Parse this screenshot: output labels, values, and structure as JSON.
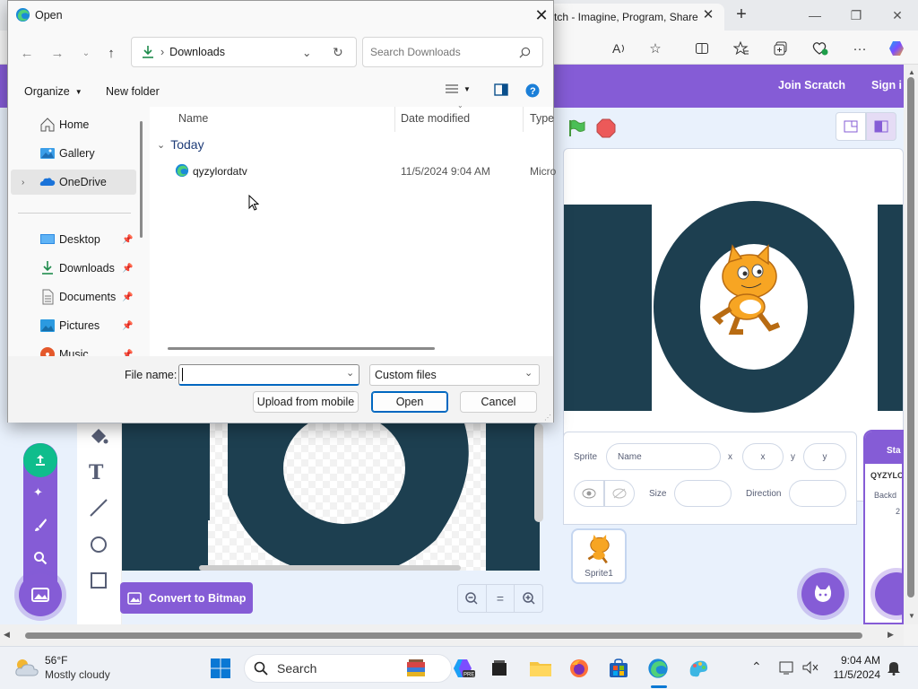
{
  "browser": {
    "tab_title": "tch - Imagine, Program, Share",
    "new_tab": "+",
    "tab_close": "✕"
  },
  "scratch": {
    "join": "Join Scratch",
    "sign_in": "Sign i",
    "sprite_label": "Sprite",
    "sprite_name_placeholder": "Name",
    "x_label": "x",
    "x_placeholder": "x",
    "y_label": "y",
    "y_placeholder": "y",
    "size_label": "Size",
    "direction_label": "Direction",
    "sprite1": "Sprite1",
    "stage_tab": "Sta",
    "stage_name": "QYZYLO",
    "backdrop_label": "Backd",
    "backdrop_count": "2",
    "convert_bitmap": "Convert to Bitmap",
    "stage_text": "LOI",
    "accent": "#855cd6"
  },
  "dialog": {
    "title": "Open",
    "path_current": "Downloads",
    "search_placeholder": "Search Downloads",
    "organize": "Organize",
    "new_folder": "New folder",
    "nav_items": [
      {
        "label": "Home",
        "icon": "home-icon"
      },
      {
        "label": "Gallery",
        "icon": "gallery-icon"
      },
      {
        "label": "OneDrive",
        "icon": "onedrive-icon"
      },
      {
        "label": "Desktop",
        "icon": "desktop-icon"
      },
      {
        "label": "Downloads",
        "icon": "download-icon"
      },
      {
        "label": "Documents",
        "icon": "documents-icon"
      },
      {
        "label": "Pictures",
        "icon": "pictures-icon"
      },
      {
        "label": "Music",
        "icon": "music-icon"
      }
    ],
    "columns": {
      "name": "Name",
      "date": "Date modified",
      "type": "Type"
    },
    "group": "Today",
    "files": [
      {
        "name": "qyzylordatv",
        "date": "11/5/2024 9:04 AM",
        "type": "Micro"
      }
    ],
    "file_name_label": "File name:",
    "file_name_value": "",
    "filter_value": "Custom files",
    "upload_mobile": "Upload from mobile",
    "open": "Open",
    "cancel": "Cancel"
  },
  "taskbar": {
    "temp": "56°F",
    "weather": "Mostly cloudy",
    "search": "Search",
    "time": "9:04 AM",
    "date": "11/5/2024"
  }
}
